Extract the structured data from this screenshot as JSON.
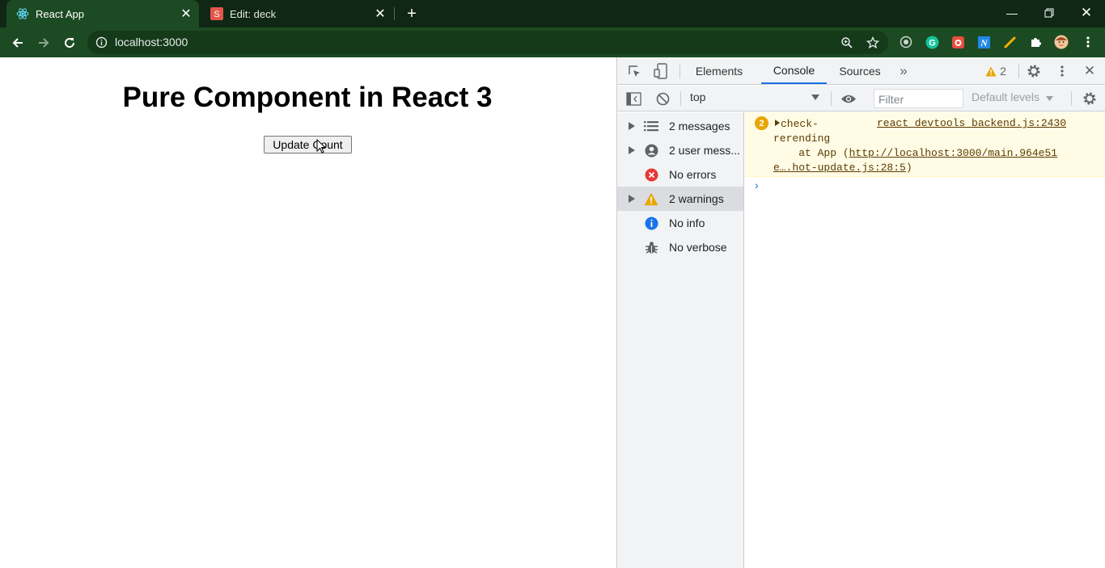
{
  "browser": {
    "tabs": [
      {
        "title": "React App",
        "icon": "react-icon",
        "active": true
      },
      {
        "title": "Edit: deck",
        "icon": "slides-icon",
        "active": false
      }
    ],
    "url": "localhost:3000"
  },
  "page": {
    "heading": "Pure Component in React 3",
    "button_label": "Update Count"
  },
  "devtools": {
    "tabs": [
      "Elements",
      "Console",
      "Sources"
    ],
    "selected_tab": "Console",
    "warning_count": "2",
    "context": "top",
    "filter_placeholder": "Filter",
    "levels_label": "Default levels",
    "sidebar": [
      {
        "label": "2 messages",
        "icon": "list-icon",
        "expandable": true
      },
      {
        "label": "2 user mess...",
        "icon": "user-icon",
        "expandable": true
      },
      {
        "label": "No errors",
        "icon": "error-icon",
        "expandable": false
      },
      {
        "label": "2 warnings",
        "icon": "warning-icon",
        "expandable": true
      },
      {
        "label": "No info",
        "icon": "info-icon",
        "expandable": false
      },
      {
        "label": "No verbose",
        "icon": "bug-icon",
        "expandable": false
      }
    ],
    "console": {
      "message_count": "2",
      "message_line1": "check-",
      "message_line2": "rerending",
      "message_line3_prefix": "    at App (",
      "message_link": "http://localhost:3000/main.964e51",
      "message_link2": "e….hot-update.js:28:5",
      "message_suffix": ")",
      "source": "react_devtools_backend.js:2430",
      "prompt": "›"
    }
  },
  "colors": {
    "chrome_frame": "#0f2714",
    "chrome_toolbar": "#1c4a22",
    "accent": "#1a73e8",
    "warning_bg": "#fffbe5"
  }
}
